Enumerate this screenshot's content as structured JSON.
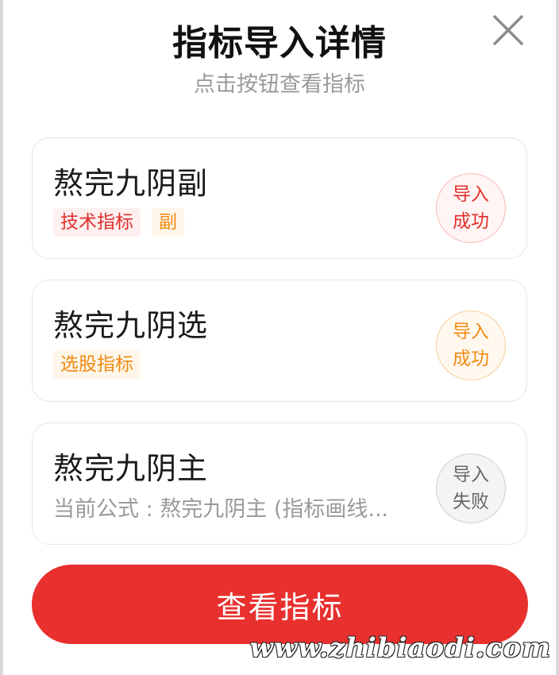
{
  "dialog": {
    "title": "指标导入详情",
    "subtitle": "点击按钮查看指标",
    "close_icon": "close-icon"
  },
  "cards": [
    {
      "name": "熬完九阴副",
      "tags": [
        "技术指标",
        "副"
      ],
      "status_line1": "导入",
      "status_line2": "成功",
      "status": "success",
      "status_color": "#e0302c"
    },
    {
      "name": "熬完九阴选",
      "tags": [
        "选股指标"
      ],
      "status_line1": "导入",
      "status_line2": "成功",
      "status": "success",
      "status_color": "#f08a12"
    },
    {
      "name": "熬完九阴主",
      "formula": "当前公式 : 熬完九阴主 (指标画线...",
      "status_line1": "导入",
      "status_line2": "失败",
      "status": "failed",
      "status_color": "#666666"
    }
  ],
  "cta": {
    "label": "查看指标",
    "color": "#e8302e"
  },
  "watermark": "www.zhibiaodi.com"
}
